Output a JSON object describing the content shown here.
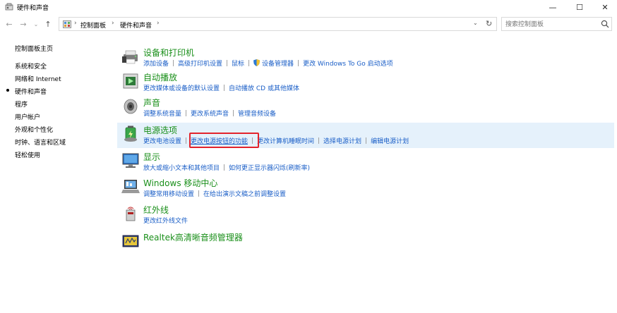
{
  "window": {
    "title": "硬件和声音",
    "minimize": "—",
    "maximize": "☐",
    "close": "✕"
  },
  "nav": {
    "back": "←",
    "forward": "→",
    "history": "⌄",
    "up": "↑"
  },
  "address": {
    "separator": "›",
    "crumbs": [
      "控制面板",
      "硬件和声音"
    ],
    "dropdown": "⌄",
    "refresh": "↻"
  },
  "search": {
    "placeholder": "搜索控制面板"
  },
  "sidebar": {
    "items": [
      {
        "label": "控制面板主页"
      },
      {
        "label": "系统和安全"
      },
      {
        "label": "网络和 Internet"
      },
      {
        "label": "硬件和声音",
        "current": true
      },
      {
        "label": "程序"
      },
      {
        "label": "用户帐户"
      },
      {
        "label": "外观和个性化"
      },
      {
        "label": "时钟、语言和区域"
      },
      {
        "label": "轻松使用"
      }
    ]
  },
  "categories": [
    {
      "heading": "设备和打印机",
      "icon": "printer-icon",
      "links": [
        "添加设备",
        "高级打印机设置",
        "鼠标",
        "设备管理器",
        "更改 Windows To Go 启动选项"
      ]
    },
    {
      "heading": "自动播放",
      "icon": "autoplay-icon",
      "links": [
        "更改媒体或设备的默认设置",
        "自动播放 CD 或其他媒体"
      ]
    },
    {
      "heading": "声音",
      "icon": "speaker-icon",
      "links": [
        "调整系统音量",
        "更改系统声音",
        "管理音频设备"
      ]
    },
    {
      "heading": "电源选项",
      "icon": "power-options-icon",
      "links": [
        "更改电池设置",
        "更改电源按钮的功能",
        "更改计算机睡眠时间",
        "选择电源计划",
        "编辑电源计划"
      ]
    },
    {
      "heading": "显示",
      "icon": "display-icon",
      "links": [
        "放大或缩小文本和其他项目",
        "如何更正显示器闪烁(刷新率)"
      ]
    },
    {
      "heading": "Windows 移动中心",
      "icon": "mobility-center-icon",
      "links": [
        "调整常用移动设置",
        "在给出演示文稿之前调整设置"
      ]
    },
    {
      "heading": "红外线",
      "icon": "infrared-icon",
      "links": [
        "更改红外线文件"
      ]
    },
    {
      "heading": "Realtek高清晰音频管理器",
      "icon": "realtek-icon",
      "links": []
    }
  ],
  "colors": {
    "heading_green": "#1a8f1a",
    "link_blue": "#1a5ec7",
    "highlight_bg": "#e5f1fb",
    "annotation_red": "#e3232b"
  }
}
